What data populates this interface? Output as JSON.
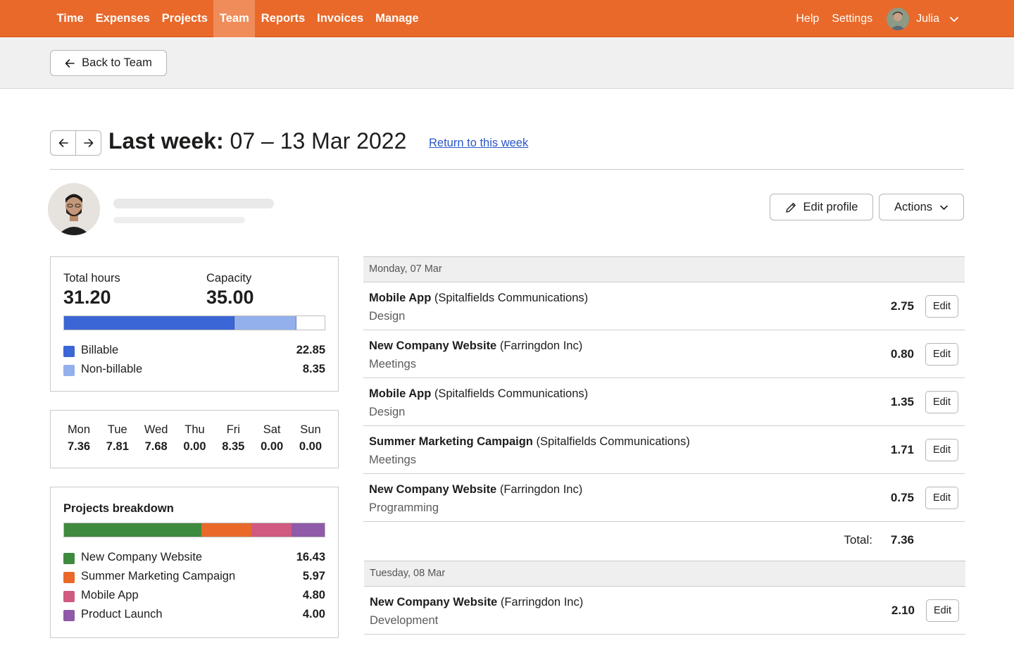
{
  "nav": {
    "items": [
      {
        "label": "Time",
        "active": false
      },
      {
        "label": "Expenses",
        "active": false
      },
      {
        "label": "Projects",
        "active": false
      },
      {
        "label": "Team",
        "active": true
      },
      {
        "label": "Reports",
        "active": false
      },
      {
        "label": "Invoices",
        "active": false
      },
      {
        "label": "Manage",
        "active": false
      }
    ],
    "help": "Help",
    "settings": "Settings",
    "user": "Julia",
    "accent": "#e8692a"
  },
  "subheader": {
    "back_label": "Back to Team"
  },
  "week": {
    "prefix": "Last week:",
    "range": "07 – 13 Mar 2022",
    "return_link": "Return to this week"
  },
  "profile": {
    "edit_label": "Edit profile",
    "actions_label": "Actions"
  },
  "summary": {
    "total_label": "Total hours",
    "total_value": "31.20",
    "capacity_label": "Capacity",
    "capacity_value": "35.00",
    "legend": [
      {
        "name": "Billable",
        "value": "22.85",
        "color": "#3b66d6"
      },
      {
        "name": "Non-billable",
        "value": "8.35",
        "color": "#93b0ec"
      }
    ]
  },
  "days": [
    {
      "name": "Mon",
      "value": "7.36"
    },
    {
      "name": "Tue",
      "value": "7.81"
    },
    {
      "name": "Wed",
      "value": "7.68"
    },
    {
      "name": "Thu",
      "value": "0.00"
    },
    {
      "name": "Fri",
      "value": "8.35"
    },
    {
      "name": "Sat",
      "value": "0.00"
    },
    {
      "name": "Sun",
      "value": "0.00"
    }
  ],
  "projects": {
    "title": "Projects breakdown",
    "items": [
      {
        "name": "New Company Website",
        "value": "16.43",
        "color": "#3e8a3e"
      },
      {
        "name": "Summer Marketing Campaign",
        "value": "5.97",
        "color": "#e8692a"
      },
      {
        "name": "Mobile App",
        "value": "4.80",
        "color": "#d05a80"
      },
      {
        "name": "Product Launch",
        "value": "4.00",
        "color": "#8f5aa8"
      }
    ]
  },
  "entries": {
    "edit_label": "Edit",
    "total_label": "Total:",
    "monday": {
      "header": "Monday, 07 Mar",
      "total": "7.36",
      "rows": [
        {
          "project": "Mobile App",
          "client": " (Spitalfields Communications)",
          "task": "Design",
          "hours": "2.75"
        },
        {
          "project": "New Company Website",
          "client": " (Farringdon Inc)",
          "task": "Meetings",
          "hours": "0.80"
        },
        {
          "project": "Mobile App",
          "client": " (Spitalfields Communications)",
          "task": "Design",
          "hours": "1.35"
        },
        {
          "project": "Summer Marketing Campaign",
          "client": " (Spitalfields Communications)",
          "task": "Meetings",
          "hours": "1.71"
        },
        {
          "project": "New Company Website",
          "client": " (Farringdon Inc)",
          "task": "Programming",
          "hours": "0.75"
        }
      ]
    },
    "tuesday": {
      "header": "Tuesday, 08 Mar",
      "rows": [
        {
          "project": "New Company Website",
          "client": " (Farringdon Inc)",
          "task": "Development",
          "hours": "2.10"
        }
      ]
    }
  }
}
